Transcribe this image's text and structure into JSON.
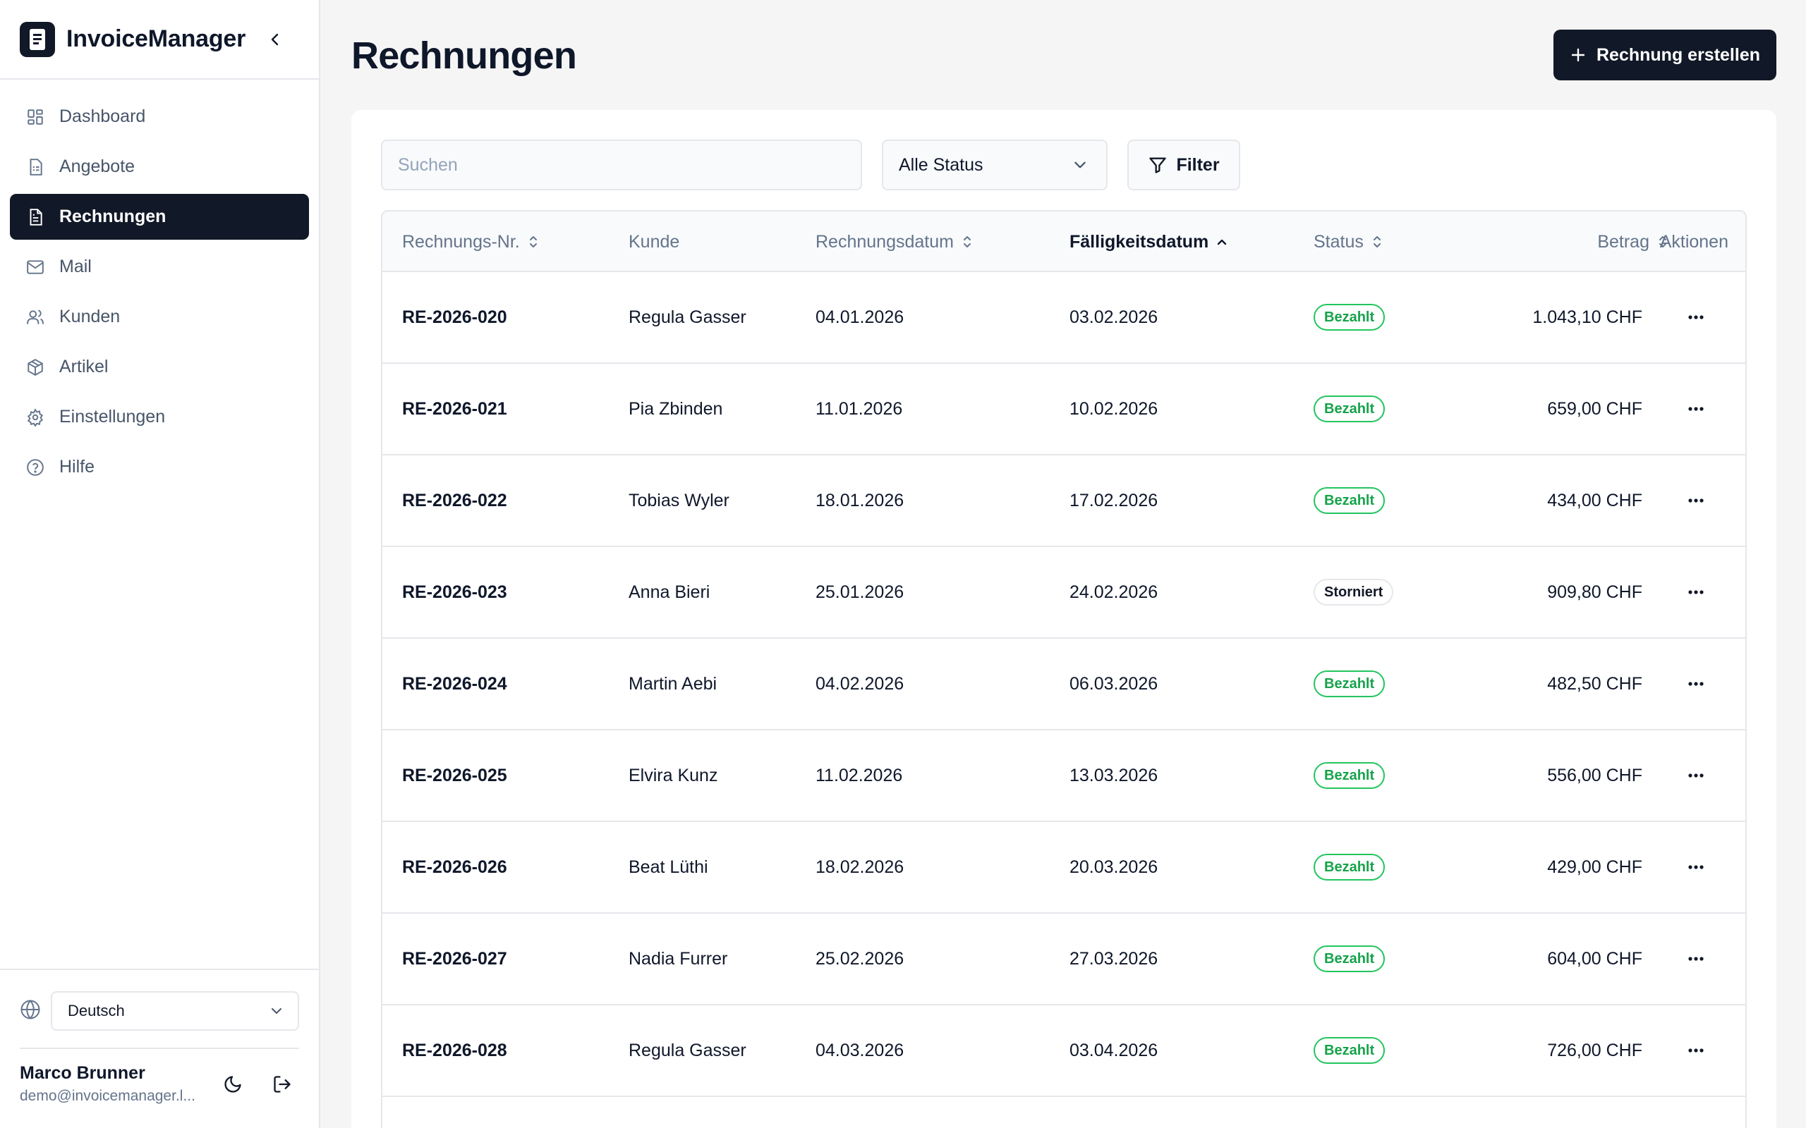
{
  "app": {
    "name": "InvoiceManager"
  },
  "sidebar": {
    "items": [
      {
        "label": "Dashboard",
        "icon": "dashboard-icon"
      },
      {
        "label": "Angebote",
        "icon": "file-list-icon"
      },
      {
        "label": "Rechnungen",
        "icon": "file-text-icon",
        "active": true
      },
      {
        "label": "Mail",
        "icon": "mail-icon"
      },
      {
        "label": "Kunden",
        "icon": "users-icon"
      },
      {
        "label": "Artikel",
        "icon": "package-icon"
      },
      {
        "label": "Einstellungen",
        "icon": "gear-icon"
      },
      {
        "label": "Hilfe",
        "icon": "help-circle-icon"
      }
    ],
    "language": "Deutsch",
    "user": {
      "name": "Marco Brunner",
      "email": "demo@invoicemanager.l..."
    }
  },
  "main": {
    "title": "Rechnungen",
    "create_label": "Rechnung erstellen",
    "search_placeholder": "Suchen",
    "status_filter": "Alle Status",
    "filter_label": "Filter",
    "columns": [
      "Rechnungs-Nr.",
      "Kunde",
      "Rechnungsdatum",
      "Fälligkeitsdatum",
      "Status",
      "Betrag",
      "Aktionen"
    ],
    "rows": [
      {
        "nr": "RE-2026-020",
        "kunde": "Regula Gasser",
        "datum": "04.01.2026",
        "faellig": "03.02.2026",
        "status": "Bezahlt",
        "betrag": "1.043,10 CHF"
      },
      {
        "nr": "RE-2026-021",
        "kunde": "Pia Zbinden",
        "datum": "11.01.2026",
        "faellig": "10.02.2026",
        "status": "Bezahlt",
        "betrag": "659,00 CHF"
      },
      {
        "nr": "RE-2026-022",
        "kunde": "Tobias Wyler",
        "datum": "18.01.2026",
        "faellig": "17.02.2026",
        "status": "Bezahlt",
        "betrag": "434,00 CHF"
      },
      {
        "nr": "RE-2026-023",
        "kunde": "Anna Bieri",
        "datum": "25.01.2026",
        "faellig": "24.02.2026",
        "status": "Storniert",
        "betrag": "909,80 CHF"
      },
      {
        "nr": "RE-2026-024",
        "kunde": "Martin Aebi",
        "datum": "04.02.2026",
        "faellig": "06.03.2026",
        "status": "Bezahlt",
        "betrag": "482,50 CHF"
      },
      {
        "nr": "RE-2026-025",
        "kunde": "Elvira Kunz",
        "datum": "11.02.2026",
        "faellig": "13.03.2026",
        "status": "Bezahlt",
        "betrag": "556,00 CHF"
      },
      {
        "nr": "RE-2026-026",
        "kunde": "Beat Lüthi",
        "datum": "18.02.2026",
        "faellig": "20.03.2026",
        "status": "Bezahlt",
        "betrag": "429,00 CHF"
      },
      {
        "nr": "RE-2026-027",
        "kunde": "Nadia Furrer",
        "datum": "25.02.2026",
        "faellig": "27.03.2026",
        "status": "Bezahlt",
        "betrag": "604,00 CHF"
      },
      {
        "nr": "RE-2026-028",
        "kunde": "Regula Gasser",
        "datum": "04.03.2026",
        "faellig": "03.04.2026",
        "status": "Bezahlt",
        "betrag": "726,00 CHF"
      }
    ]
  },
  "colors": {
    "primary": "#111827",
    "paid": "#16a34a",
    "paid_border": "#22c55e",
    "muted": "#64748b"
  }
}
